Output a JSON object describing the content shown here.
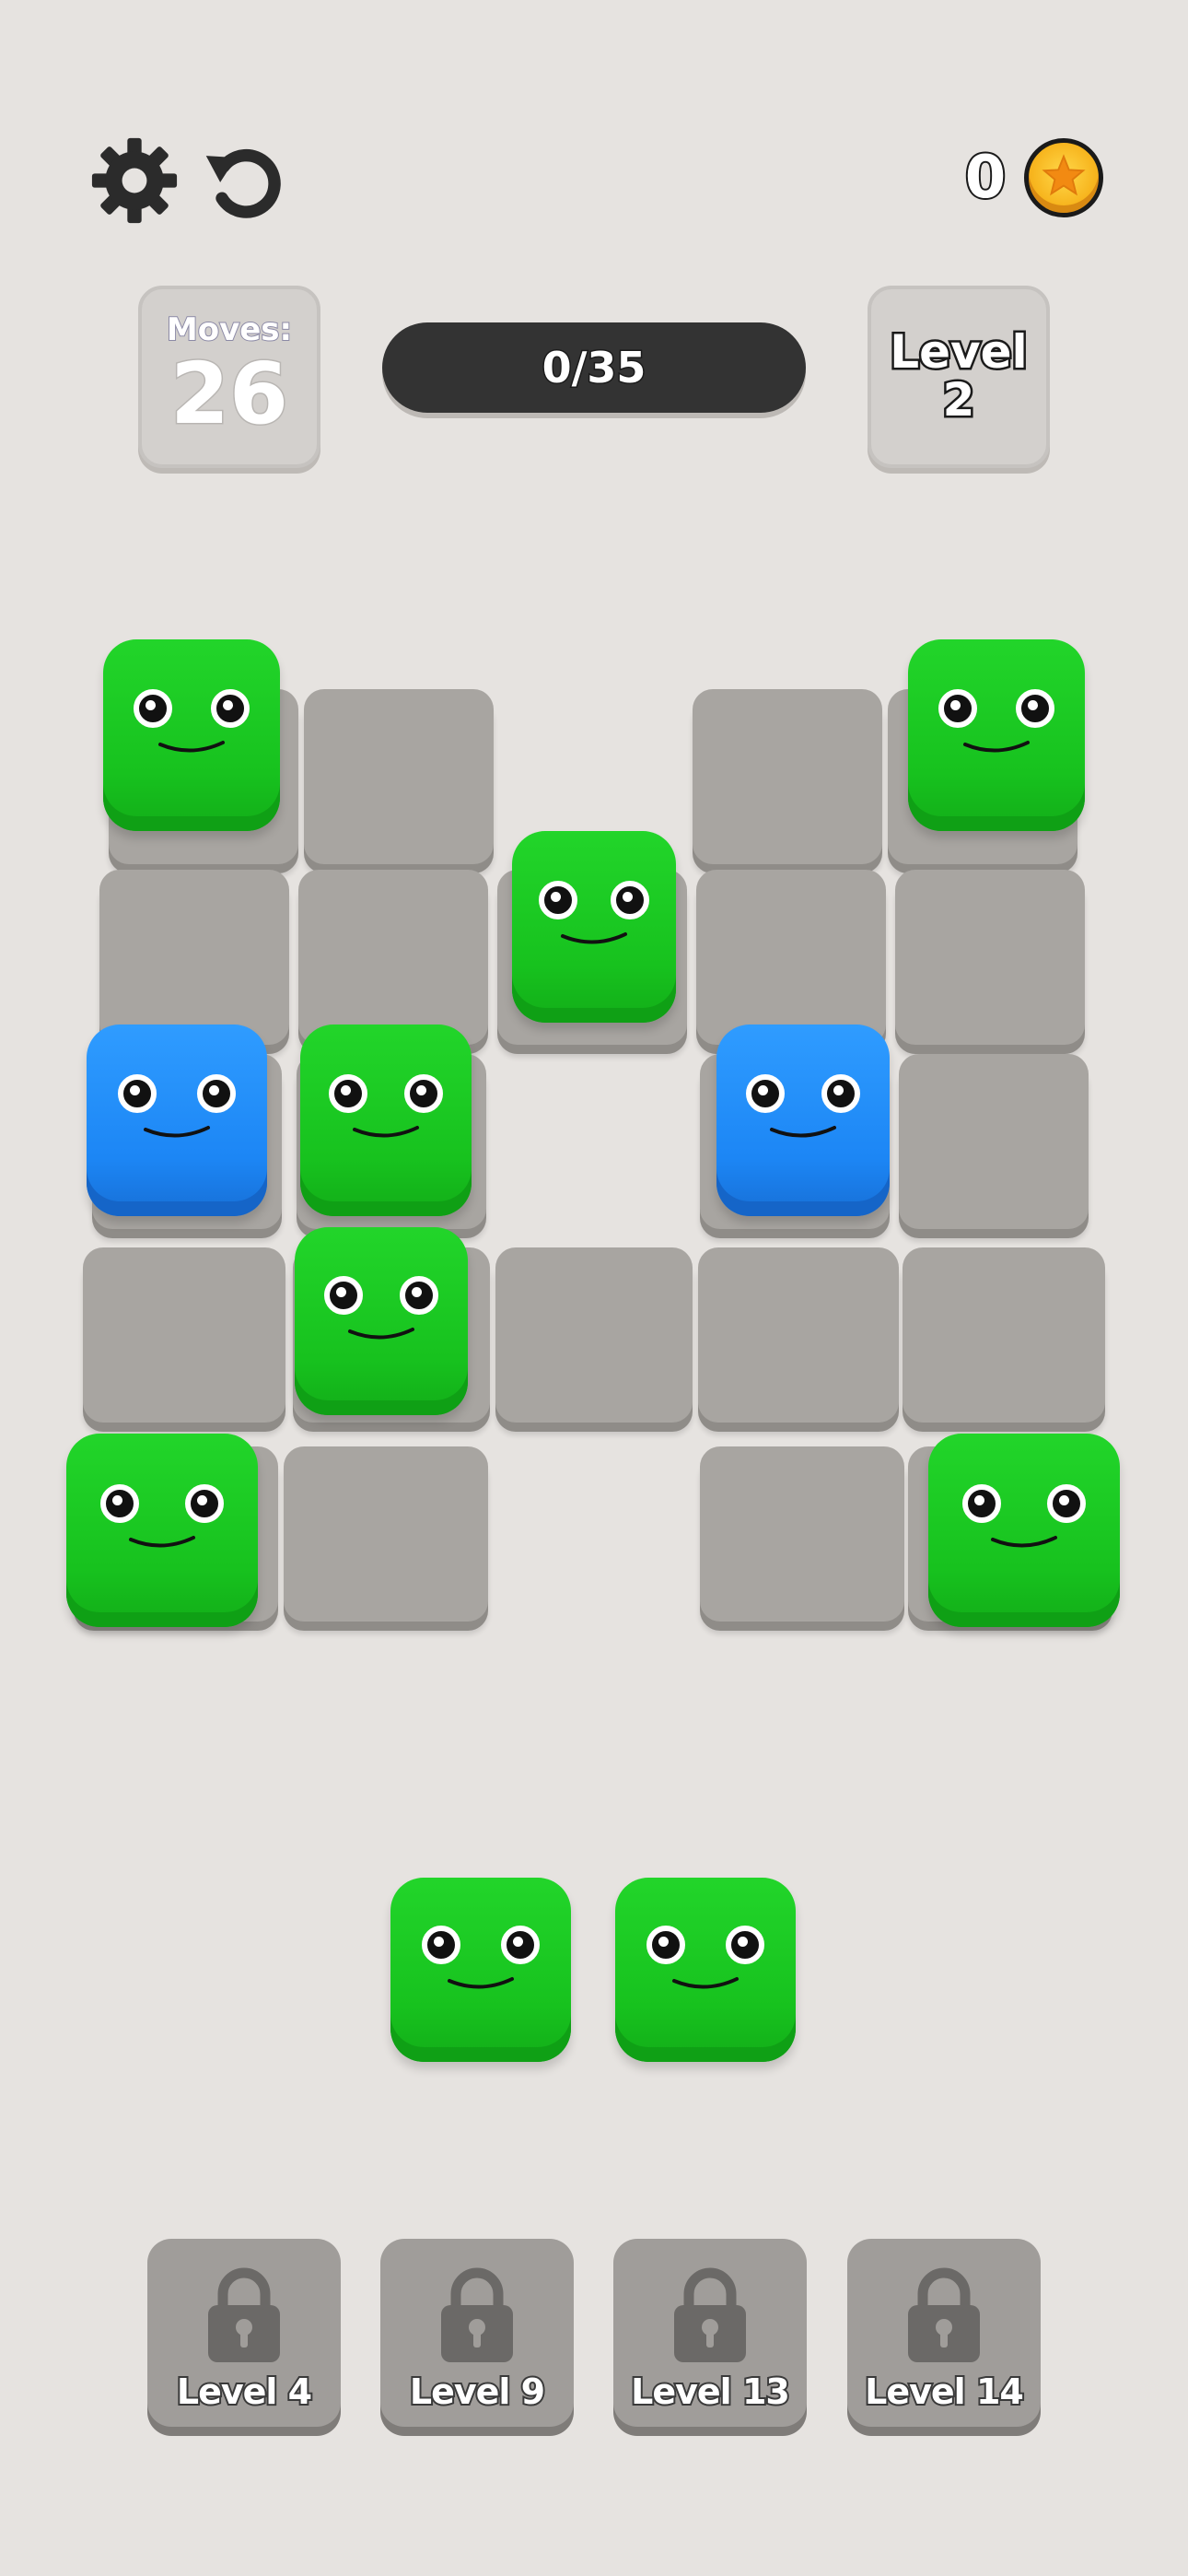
{
  "top_bar": {
    "settings_icon": "gear-icon",
    "restart_icon": "restart-icon",
    "coins": "0",
    "coin_icon": "coin-star-icon"
  },
  "stats": {
    "moves_label": "Moves:",
    "moves_value": "26",
    "progress_text": "0/35",
    "progress_fraction": 0,
    "level_line1": "Level",
    "level_line2": "2"
  },
  "colors": {
    "green_cube": "#1ec826",
    "blue_cube": "#2390f7",
    "tile": "#a8a5a1",
    "background": "#e6e3e0"
  },
  "board_cubes": [
    {
      "color": "green"
    },
    {
      "color": "green"
    },
    {
      "color": "green"
    },
    {
      "color": "blue"
    },
    {
      "color": "green"
    },
    {
      "color": "blue"
    },
    {
      "color": "green"
    },
    {
      "color": "green"
    },
    {
      "color": "green"
    }
  ],
  "tray_cubes": [
    {
      "color": "green"
    },
    {
      "color": "green"
    }
  ],
  "locked_levels": [
    {
      "label": "Level 4"
    },
    {
      "label": "Level 9"
    },
    {
      "label": "Level 13"
    },
    {
      "label": "Level 14"
    }
  ]
}
